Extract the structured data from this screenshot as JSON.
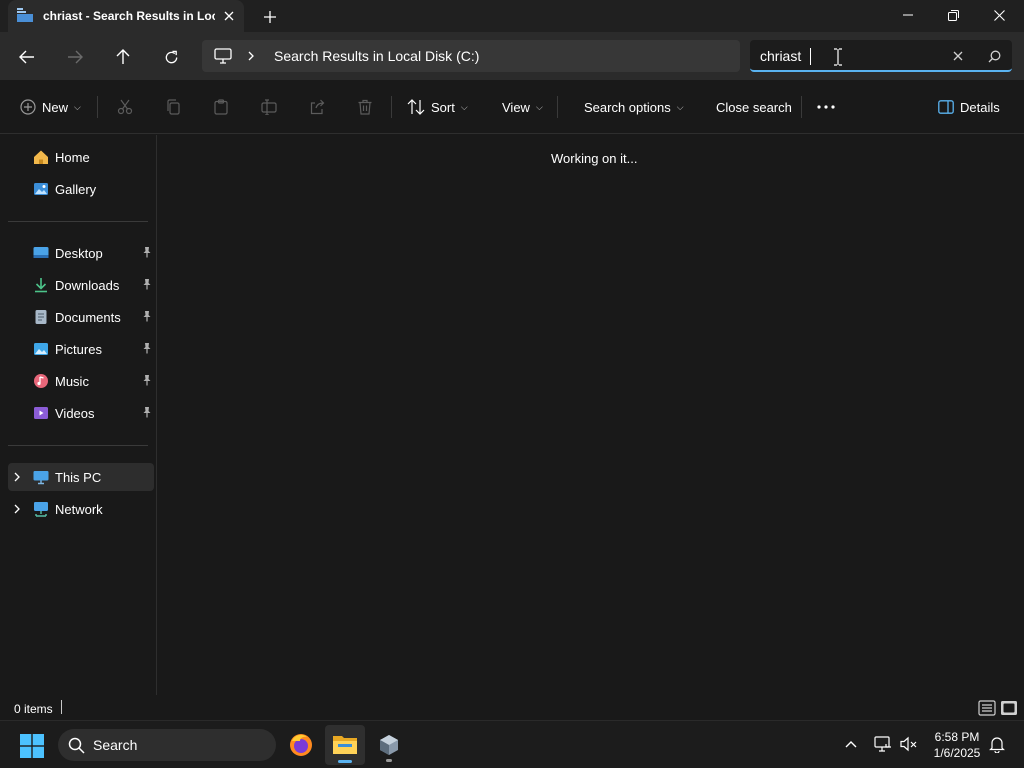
{
  "window": {
    "tab_title": "chriast - Search Results in Local Disk (C:)",
    "address_path": "Search Results in Local Disk (C:)",
    "search_value": "chriast"
  },
  "commandbar": {
    "new_label": "New",
    "sort_label": "Sort",
    "view_label": "View",
    "search_options_label": "Search options",
    "close_search_label": "Close search",
    "details_label": "Details"
  },
  "sidebar": {
    "home": "Home",
    "gallery": "Gallery",
    "desktop": "Desktop",
    "downloads": "Downloads",
    "documents": "Documents",
    "pictures": "Pictures",
    "music": "Music",
    "videos": "Videos",
    "this_pc": "This PC",
    "network": "Network"
  },
  "content": {
    "status_message": "Working on it..."
  },
  "statusbar": {
    "item_count": "0 items"
  },
  "taskbar": {
    "search_label": "Search",
    "time": "6:58 PM",
    "date": "1/6/2025"
  },
  "colors": {
    "accent": "#5ab3f0",
    "background": "#191919"
  }
}
